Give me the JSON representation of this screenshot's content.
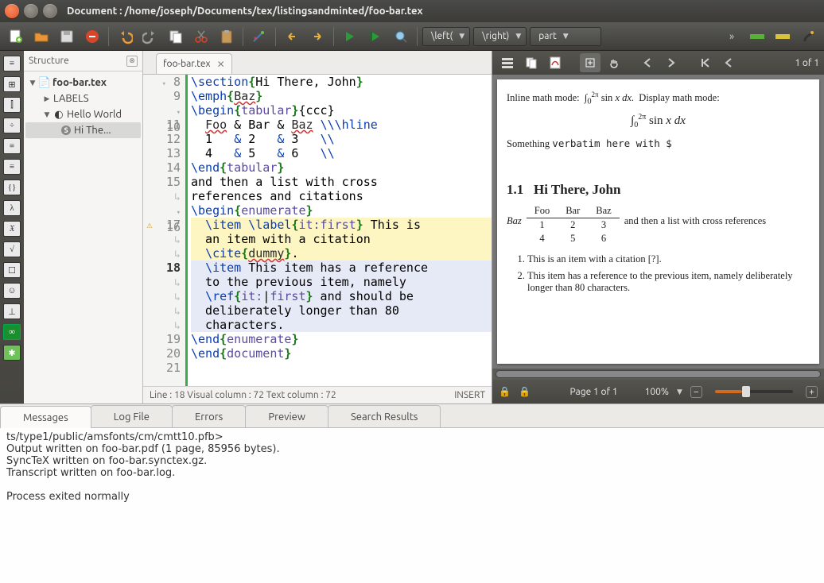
{
  "window": {
    "title": "Document : /home/joseph/Documents/tex/listingsandminted/foo-bar.tex"
  },
  "toolbar": {
    "combo_left": "\\left(",
    "combo_right": "\\right)",
    "combo_part": "part"
  },
  "sidebar_glyphs": [
    "≡",
    "⊞",
    "⫿",
    "÷",
    "≡",
    "≡",
    "{}",
    "λ",
    "𝔛",
    "√",
    "☐",
    "☺",
    "⊥",
    "∞",
    "✱"
  ],
  "structure": {
    "title": "Structure",
    "root": "foo-bar.tex",
    "labels": "LABELS",
    "hello": "Hello World",
    "hi": "Hi The..."
  },
  "tab": {
    "label": "foo-bar.tex"
  },
  "editor": {
    "lines": [
      {
        "n": "8",
        "fold": "▾",
        "mark": "",
        "segs": [
          [
            "kw",
            "\\section"
          ],
          [
            "br",
            "{"
          ],
          [
            "",
            "Hi There, John"
          ],
          [
            "br",
            "}"
          ]
        ]
      },
      {
        "n": "9",
        "fold": "",
        "mark": "",
        "segs": [
          [
            "kw",
            "\\emph"
          ],
          [
            "br",
            "{"
          ],
          [
            "err",
            "Baz"
          ],
          [
            "br",
            "}"
          ]
        ]
      },
      {
        "n": "10",
        "fold": "▾",
        "mark": "",
        "segs": [
          [
            "kw",
            "\\begin"
          ],
          [
            "br",
            "{"
          ],
          [
            "str",
            "tabular"
          ],
          [
            "br",
            "}"
          ],
          [
            "",
            "{ccc}"
          ]
        ]
      },
      {
        "n": "11",
        "fold": "",
        "mark": "",
        "segs": [
          [
            "",
            "  "
          ],
          [
            "err",
            "Foo"
          ],
          [
            "",
            " & Bar & "
          ],
          [
            "err",
            "Baz"
          ],
          [
            "",
            " "
          ],
          [
            "kw",
            "\\\\\\hline"
          ]
        ]
      },
      {
        "n": "12",
        "fold": "",
        "mark": "",
        "segs": [
          [
            "",
            "  1   "
          ],
          [
            "kw",
            "&"
          ],
          [
            "",
            " 2   "
          ],
          [
            "kw",
            "&"
          ],
          [
            "",
            " 3   "
          ],
          [
            "kw",
            "\\\\"
          ]
        ]
      },
      {
        "n": "13",
        "fold": "",
        "mark": "",
        "segs": [
          [
            "",
            "  4   "
          ],
          [
            "kw",
            "&"
          ],
          [
            "",
            " 5   "
          ],
          [
            "kw",
            "&"
          ],
          [
            "",
            " 6   "
          ],
          [
            "kw",
            "\\\\"
          ]
        ]
      },
      {
        "n": "14",
        "fold": "",
        "mark": "",
        "segs": [
          [
            "kw",
            "\\end"
          ],
          [
            "br",
            "{"
          ],
          [
            "str",
            "tabular"
          ],
          [
            "br",
            "}"
          ]
        ]
      },
      {
        "n": "15",
        "fold": "",
        "mark": "",
        "segs": [
          [
            "",
            "and then a list with cross"
          ]
        ]
      },
      {
        "n": "↳",
        "fold": "",
        "mark": "",
        "segs": [
          [
            "",
            "references and citations"
          ]
        ]
      },
      {
        "n": "16",
        "fold": "▾",
        "mark": "",
        "segs": [
          [
            "kw",
            "\\begin"
          ],
          [
            "br",
            "{"
          ],
          [
            "str",
            "enumerate"
          ],
          [
            "br",
            "}"
          ]
        ]
      },
      {
        "n": "17",
        "fold": "",
        "mark": "⚠",
        "bg": "y",
        "segs": [
          [
            "",
            "  "
          ],
          [
            "kw",
            "\\item"
          ],
          [
            "",
            " "
          ],
          [
            "kw",
            "\\label"
          ],
          [
            "br",
            "{"
          ],
          [
            "str",
            "it:first"
          ],
          [
            "br",
            "}"
          ],
          [
            "",
            " This is"
          ]
        ]
      },
      {
        "n": "↳",
        "fold": "",
        "mark": "",
        "bg": "y",
        "segs": [
          [
            "",
            "  an item with a citation"
          ]
        ]
      },
      {
        "n": "↳",
        "fold": "",
        "mark": "",
        "bg": "y",
        "segs": [
          [
            "",
            "  "
          ],
          [
            "kw",
            "\\cite"
          ],
          [
            "br",
            "{"
          ],
          [
            "err",
            "dummy"
          ],
          [
            "br",
            "}"
          ],
          [
            "",
            "."
          ]
        ]
      },
      {
        "n": "18",
        "fold": "",
        "mark": "",
        "bg": "b",
        "segs": [
          [
            "",
            "  "
          ],
          [
            "kw",
            "\\item"
          ],
          [
            "",
            " This item has a reference"
          ]
        ]
      },
      {
        "n": "↳",
        "fold": "",
        "mark": "",
        "bg": "b",
        "segs": [
          [
            "",
            "  to the previous item, namely"
          ]
        ]
      },
      {
        "n": "↳",
        "fold": "",
        "mark": "",
        "bg": "b",
        "segs": [
          [
            "",
            "  "
          ],
          [
            "kw",
            "\\ref"
          ],
          [
            "br",
            "{"
          ],
          [
            "str",
            "it:"
          ],
          [
            "",
            "|"
          ],
          [
            "str",
            "first"
          ],
          [
            "br",
            "}"
          ],
          [
            "",
            " and should be"
          ]
        ]
      },
      {
        "n": "↳",
        "fold": "",
        "mark": "",
        "bg": "b",
        "segs": [
          [
            "",
            "  deliberately longer than 80"
          ]
        ]
      },
      {
        "n": "↳",
        "fold": "",
        "mark": "",
        "bg": "b",
        "segs": [
          [
            "",
            "  characters."
          ]
        ]
      },
      {
        "n": "19",
        "fold": "",
        "mark": "",
        "segs": [
          [
            "kw",
            "\\end"
          ],
          [
            "br",
            "{"
          ],
          [
            "str",
            "enumerate"
          ],
          [
            "br",
            "}"
          ]
        ]
      },
      {
        "n": "20",
        "fold": "",
        "mark": "",
        "segs": [
          [
            "kw",
            "\\end"
          ],
          [
            "br",
            "{"
          ],
          [
            "str",
            "document"
          ],
          [
            "br",
            "}"
          ]
        ]
      },
      {
        "n": "21",
        "fold": "",
        "mark": "",
        "segs": [
          [
            "",
            ""
          ]
        ]
      }
    ],
    "status_left": "Line : 18 Visual column : 72 Text column : 72",
    "status_right": "INSERT"
  },
  "preview": {
    "page_of": "1 of 1",
    "footer_page": "Page 1 of 1",
    "footer_zoom": "100%",
    "inline_text": "Inline math mode:",
    "display_text": "Display math mode:",
    "verbatim": "Something verbatim here with $",
    "section_num": "1.1",
    "section_title": "Hi There, John",
    "tbl_h": [
      "Foo",
      "Bar",
      "Baz"
    ],
    "tbl_r1": [
      "1",
      "2",
      "3"
    ],
    "tbl_r2": [
      "4",
      "5",
      "6"
    ],
    "baz_label": "Baz",
    "tbl_after": "and then a list with cross references",
    "item1": "This is an item with a citation [?].",
    "item2": "This item has a reference to the previous item, namely deliberately longer than 80 characters."
  },
  "bottom": {
    "tabs": [
      "Messages",
      "Log File",
      "Errors",
      "Preview",
      "Search Results"
    ],
    "lines": [
      "ts/type1/public/amsfonts/cm/cmtt10.pfb>",
      "Output written on foo-bar.pdf (1 page, 85956 bytes).",
      "SyncTeX written on foo-bar.synctex.gz.",
      "Transcript written on foo-bar.log.",
      "",
      "Process exited normally"
    ]
  }
}
